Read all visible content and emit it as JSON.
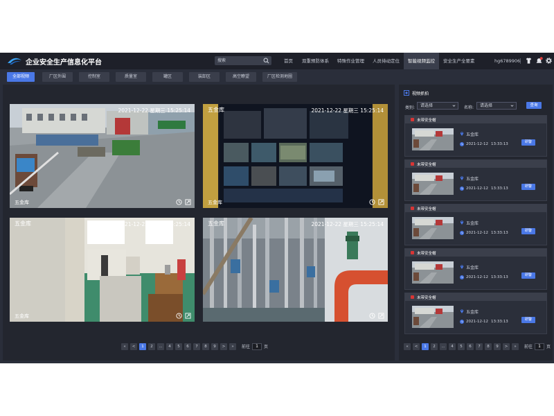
{
  "header": {
    "title": "企业安全生产信息化平台",
    "search_placeholder": "搜索",
    "nav": [
      {
        "label": "首页"
      },
      {
        "label": "双重预防体系"
      },
      {
        "label": "特殊作业管理"
      },
      {
        "label": "人员待动定位"
      },
      {
        "label": "智能视频监控",
        "active": true
      },
      {
        "label": "安全生产全要素"
      }
    ],
    "username": "hg6789906",
    "notification_count": "",
    "icons": [
      "shirt-icon",
      "bell-icon",
      "gear-icon"
    ]
  },
  "category_tabs": [
    {
      "label": "全部视频",
      "active": true
    },
    {
      "label": "厂区外围"
    },
    {
      "label": "控制室"
    },
    {
      "label": "质量室"
    },
    {
      "label": "罐区"
    },
    {
      "label": "装卸区"
    },
    {
      "label": "高空瞭望"
    },
    {
      "label": "厂区检测地圈"
    }
  ],
  "cameras": [
    {
      "name": "",
      "time": "2021-12-22 星期三 15:25:14",
      "bottom_name": "五金库"
    },
    {
      "name": "五金库",
      "time": "2021-12-22 星期三 15:25:14",
      "bottom_name": "五金库"
    },
    {
      "name": "五金库",
      "time": "2021-12-22 星期三 15:25:14",
      "bottom_name": "五金库"
    },
    {
      "name": "五金库",
      "time": "2021-12-22 星期三 15:25:14",
      "bottom_name": ""
    }
  ],
  "pager_left": {
    "pages": [
      "«",
      "<",
      "1",
      "2",
      "...",
      "4",
      "5",
      "6",
      "7",
      "8",
      "9",
      ">",
      "»"
    ],
    "active": "1",
    "goto_label": "前往",
    "goto_value": "1",
    "suffix": "页"
  },
  "alerts_panel": {
    "title": "视频抓拍",
    "category_label": "类别:",
    "category_value": "请选择",
    "name_label": "名称:",
    "name_value": "请选择",
    "query_label": "查询",
    "alerts": [
      {
        "type": "未带安全帽",
        "location": "五金库",
        "date": "2021-12-12",
        "time": "13:33:13",
        "action": "研警"
      },
      {
        "type": "未带安全帽",
        "location": "五金库",
        "date": "2021-12-12",
        "time": "13:33:13",
        "action": "研警"
      },
      {
        "type": "未带安全帽",
        "location": "五金库",
        "date": "2021-12-12",
        "time": "13:33:13",
        "action": "研警"
      },
      {
        "type": "未带安全帽",
        "location": "五金库",
        "date": "2021-12-12",
        "time": "13:33:13",
        "action": "研警"
      },
      {
        "type": "未带安全帽",
        "location": "五金库",
        "date": "2021-12-12",
        "time": "13:33:13",
        "action": "研警"
      }
    ]
  },
  "pager_right": {
    "pages": [
      "«",
      "<",
      "1",
      "2",
      "...",
      "4",
      "5",
      "6",
      "7",
      "8",
      "9",
      ">",
      "»"
    ],
    "active": "1",
    "goto_label": "前往",
    "goto_value": "1",
    "suffix": "页"
  },
  "colors": {
    "accent": "#4a78e6",
    "alert_red": "#d83535",
    "bg": "#2a2e3a",
    "panel": "#23262f"
  }
}
